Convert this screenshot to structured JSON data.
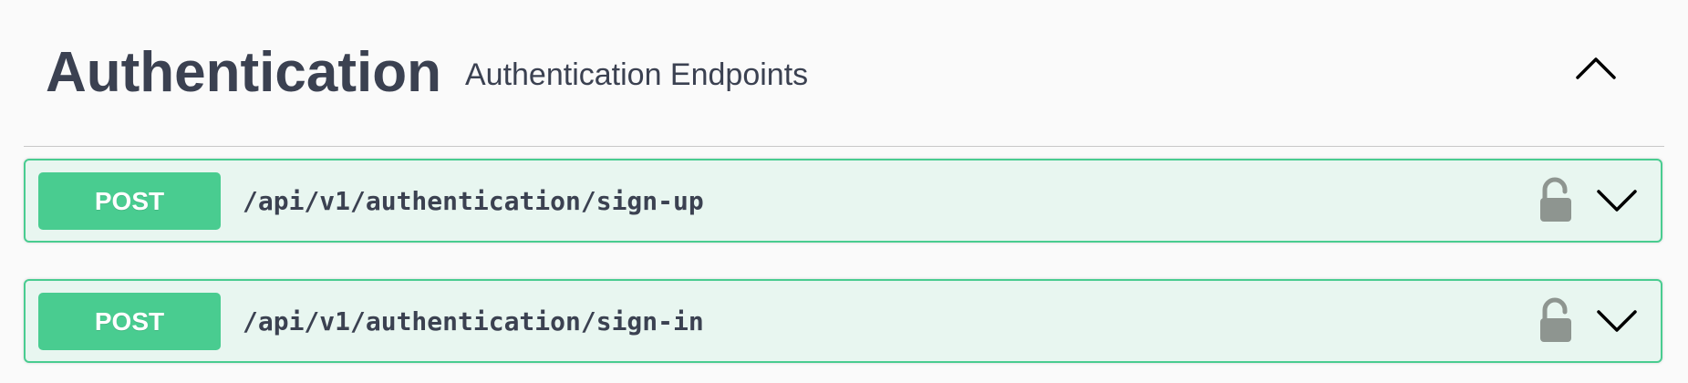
{
  "tag": {
    "title": "Authentication",
    "description": "Authentication Endpoints",
    "toggle_icon": "chevron-up-icon"
  },
  "operations": [
    {
      "method": "POST",
      "path": "/api/v1/authentication/sign-up",
      "lock_icon": "unlocked-padlock-icon",
      "expand_icon": "chevron-down-icon"
    },
    {
      "method": "POST",
      "path": "/api/v1/authentication/sign-in",
      "lock_icon": "unlocked-padlock-icon",
      "expand_icon": "chevron-down-icon"
    }
  ],
  "colors": {
    "post_accent": "#49cc90",
    "post_background": "#e8f6f0",
    "text": "#3b4151",
    "lock_gray": "#8e9590"
  }
}
